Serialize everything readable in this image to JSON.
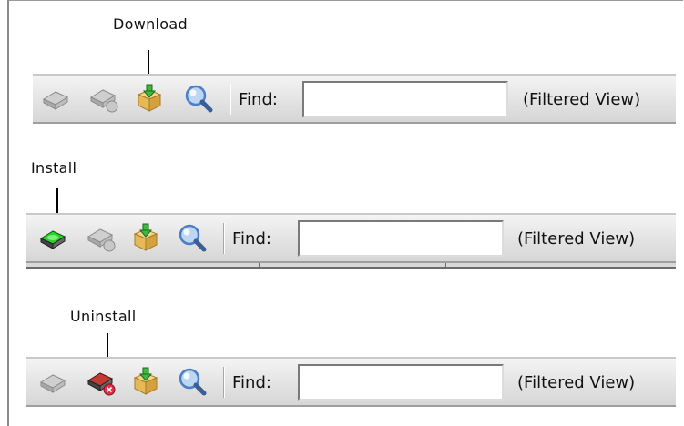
{
  "callouts": {
    "download": "Download",
    "install": "Install",
    "uninstall": "Uninstall"
  },
  "toolbar_1": {
    "find_label": "Find:",
    "find_value": "",
    "filtered_view": "(Filtered View)",
    "icons": [
      "install-disabled-icon",
      "uninstall-disabled-icon",
      "download-icon",
      "search-icon"
    ]
  },
  "toolbar_2": {
    "find_label": "Find:",
    "find_value": "",
    "filtered_view": "(Filtered View)",
    "icons": [
      "install-icon",
      "uninstall-disabled-icon",
      "download-icon",
      "search-icon"
    ]
  },
  "toolbar_3": {
    "find_label": "Find:",
    "find_value": "",
    "filtered_view": "(Filtered View)",
    "icons": [
      "install-disabled-icon",
      "uninstall-icon",
      "download-icon",
      "search-icon"
    ]
  },
  "colors": {
    "install_active": "#1fa81f",
    "uninstall_active": "#c0302a",
    "disabled": "#a6a6a6",
    "package": "#e6b85a",
    "magnifier": "#4a7fc8"
  }
}
